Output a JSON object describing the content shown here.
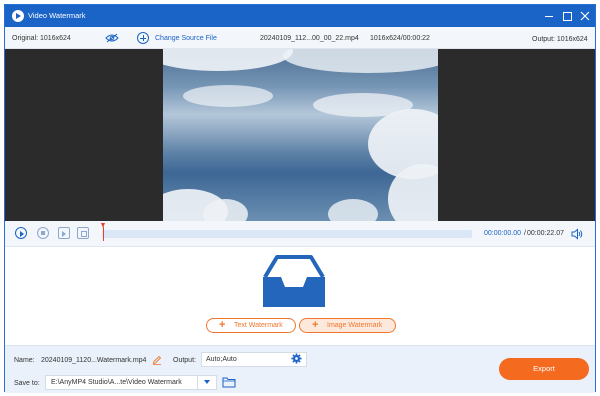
{
  "window": {
    "title": "Video Watermark",
    "icon": "app-logo-icon",
    "controls": [
      "minimize-icon",
      "maximize-icon",
      "close-icon"
    ]
  },
  "infobar": {
    "original": "Original: 1016x624",
    "change_source": "Change Source File",
    "file_name": "20240109_112...00_00_22.mp4",
    "file_meta": "1016x624/00:00:22",
    "output": "Output: 1016x624"
  },
  "timeline": {
    "current_time": "00:00:00.00",
    "separator": "/",
    "total_time": "00:00:22.07",
    "progress": 0
  },
  "watermark": {
    "text_button": "Text Watermark",
    "image_button": "Image Watermark"
  },
  "footer": {
    "name_label": "Name:",
    "name_value": "20240109_1120...Watermark.mp4",
    "output_label": "Output:",
    "output_value": "Auto;Auto",
    "saveto_label": "Save to:",
    "saveto_value": "E:\\AnyMP4 Studio\\A...te\\Video Watermark",
    "export": "Export"
  },
  "colors": {
    "accent": "#1a64c8",
    "export": "#f46a1f",
    "watermark_border": "#f0762e",
    "playhead": "#e8412b"
  }
}
